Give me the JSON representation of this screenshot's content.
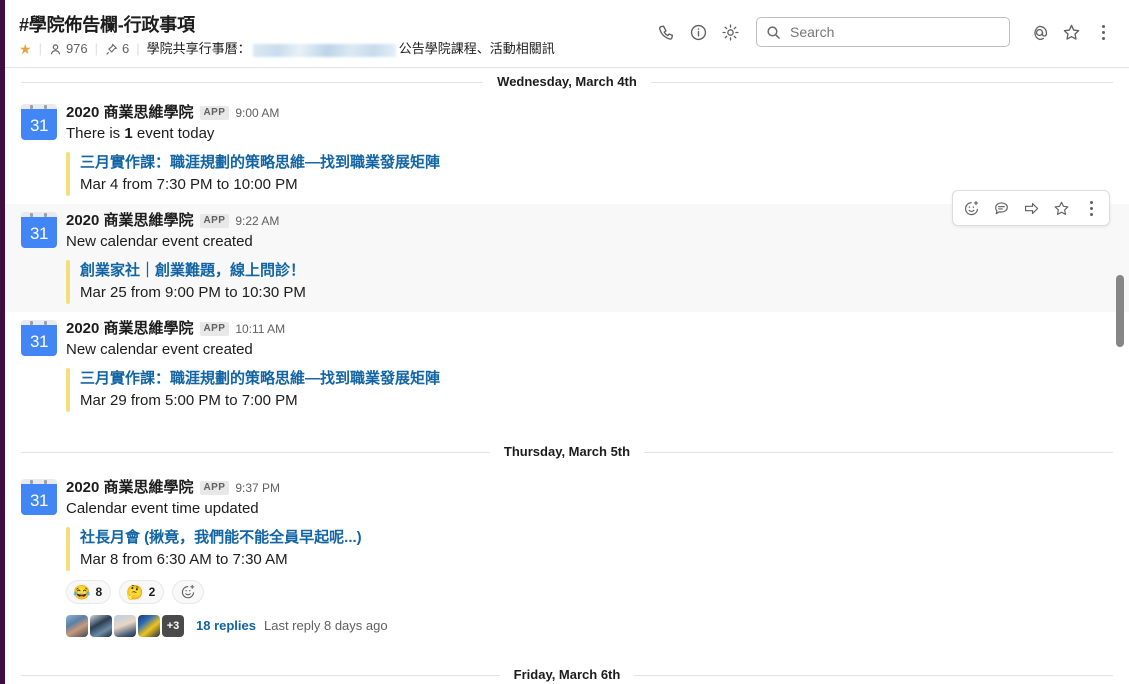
{
  "header": {
    "channel_name": "#學院佈告欄-行政事項",
    "starred": true,
    "star_icon": "star-filled-icon",
    "members_icon": "person-icon",
    "members_count": "976",
    "pins_icon": "pin-icon",
    "pins_count": "6",
    "topic_prefix": "學院共享行事曆：",
    "topic_suffix": "公告學院課程、活動相關訊",
    "separator": "|",
    "actions": {
      "call_icon": "phone-icon",
      "info_icon": "info-icon",
      "settings_icon": "gear-icon",
      "mentions_icon": "at-mention-icon",
      "saved_icon": "star-outline-icon",
      "more_icon": "kebab-menu-icon"
    },
    "search": {
      "icon": "search-icon",
      "placeholder": "Search",
      "value": ""
    }
  },
  "dividers": {
    "top": "Wednesday, March 4th",
    "middle": "Thursday, March 5th",
    "bottom": "Friday, March 6th"
  },
  "hover_toolbar": {
    "add_reaction_icon": "emoji-add-icon",
    "reply_thread_icon": "speech-bubble-icon",
    "share_icon": "forward-arrow-icon",
    "save_icon": "star-outline-icon",
    "more_icon": "kebab-menu-icon"
  },
  "messages": [
    {
      "avatar_icon": "google-calendar-icon",
      "avatar_day": "31",
      "author": "2020 商業思維學院",
      "badge": "APP",
      "time": "9:00 AM",
      "text_before": "There is ",
      "text_bold": "1",
      "text_after": " event today",
      "attachment": {
        "title": "三月實作課：職涯規劃的策略思維—找到職業發展矩陣",
        "subtitle": "Mar 4 from 7:30 PM to 10:00 PM"
      },
      "hovered": false
    },
    {
      "avatar_icon": "google-calendar-icon",
      "avatar_day": "31",
      "author": "2020 商業思維學院",
      "badge": "APP",
      "time": "9:22 AM",
      "text_before": "New calendar event created",
      "text_bold": "",
      "text_after": "",
      "attachment": {
        "title": "創業家社｜創業難題，線上問診！",
        "subtitle": "Mar 25 from 9:00 PM to 10:30 PM"
      },
      "hovered": true
    },
    {
      "avatar_icon": "google-calendar-icon",
      "avatar_day": "31",
      "author": "2020 商業思維學院",
      "badge": "APP",
      "time": "10:11 AM",
      "text_before": "New calendar event created",
      "text_bold": "",
      "text_after": "",
      "attachment": {
        "title": "三月實作課：職涯規劃的策略思維—找到職業發展矩陣",
        "subtitle": "Mar 29 from 5:00 PM to 7:00 PM"
      },
      "hovered": false
    },
    {
      "avatar_icon": "google-calendar-icon",
      "avatar_day": "31",
      "author": "2020 商業思維學院",
      "badge": "APP",
      "time": "9:37 PM",
      "text_before": "Calendar event time updated",
      "text_bold": "",
      "text_after": "",
      "attachment": {
        "title": "社長月會 (揪竟，我們能不能全員早起呢...)",
        "subtitle": "Mar 8 from 6:30 AM to 7:30 AM"
      },
      "hovered": false,
      "reactions": [
        {
          "emoji": "😂",
          "count": "8",
          "name": "joy"
        },
        {
          "emoji": "🤔",
          "count": "2",
          "name": "thinking"
        }
      ],
      "add_reaction_icon": "emoji-add-icon",
      "thread": {
        "avatar_count": 4,
        "overflow_label": "+3",
        "replies_label": "18 replies",
        "last_reply": "Last reply 8 days ago"
      }
    }
  ],
  "colors": {
    "sidebar_edge": "#3f0e40",
    "link_blue": "#1264a3",
    "attachment_bar": "#f2e07e",
    "star_yellow": "#e8a33d",
    "hover_row": "#f8f8f8",
    "text_primary": "#1d1c1d",
    "text_muted": "#616061",
    "calendar_blue": "#4285f4"
  },
  "scrollbar": {
    "position_pct": 34
  }
}
